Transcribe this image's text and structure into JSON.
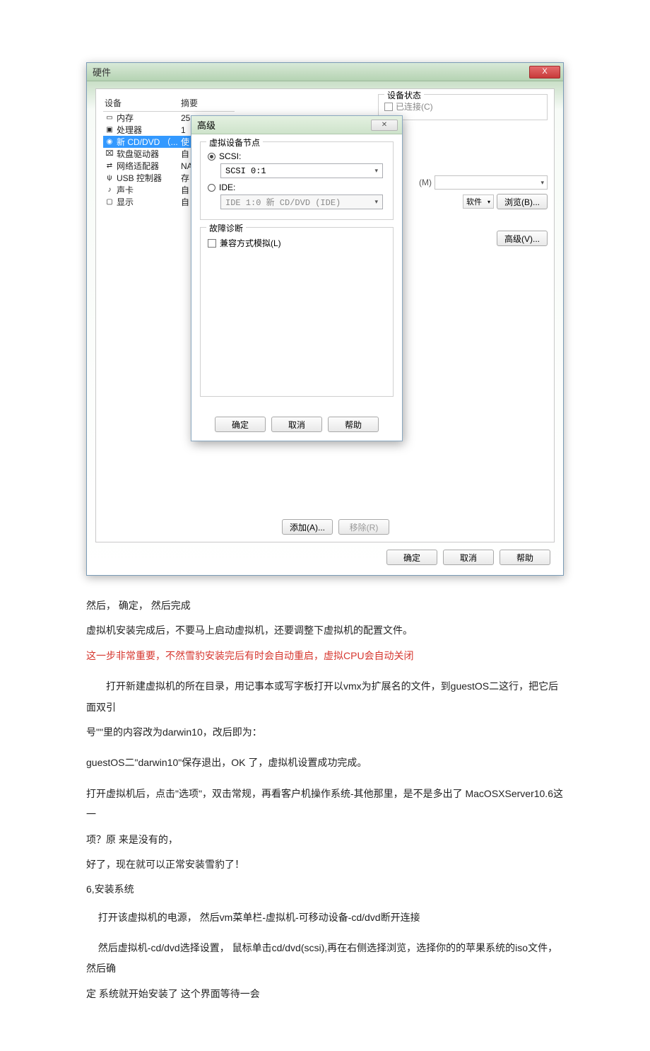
{
  "dialog": {
    "title": "硬件",
    "close_x": "X",
    "device_header": "设备",
    "summary_header": "摘要",
    "devices": [
      {
        "name": "内存",
        "summary": "25",
        "icon": "memory-icon"
      },
      {
        "name": "处理器",
        "summary": "1",
        "icon": "cpu-icon"
      },
      {
        "name": "新 CD/DVD （...",
        "summary": "使",
        "icon": "cd-icon",
        "selected": true
      },
      {
        "name": "软盘驱动器",
        "summary": "自",
        "icon": "floppy-icon"
      },
      {
        "name": "网络适配器",
        "summary": "NA",
        "icon": "nic-icon"
      },
      {
        "name": "USB 控制器",
        "summary": "存",
        "icon": "usb-icon"
      },
      {
        "name": "声卡",
        "summary": "自",
        "icon": "sound-icon"
      },
      {
        "name": "显示",
        "summary": "自",
        "icon": "display-icon"
      }
    ],
    "status_group": "设备状态",
    "status_connected": "已连接(C)",
    "m_label": "(M)",
    "browse_dd": "软件",
    "browse_btn": "浏览(B)...",
    "advanced_btn": "高级(V)...",
    "add_btn": "添加(A)...",
    "remove_btn": "移除(R)",
    "ok": "确定",
    "cancel": "取消",
    "help": "帮助"
  },
  "adv": {
    "title": "高级",
    "close_x": "✕",
    "node_group": "虚拟设备节点",
    "scsi_label": "SCSI:",
    "scsi_value": "SCSI 0:1",
    "ide_label": "IDE:",
    "ide_value": "IDE 1:0  新 CD/DVD (IDE)",
    "troubleshoot_group": "故障诊断",
    "legacy_label": "兼容方式模拟(L)",
    "ok": "确定",
    "cancel": "取消",
    "help": "帮助"
  },
  "article": {
    "p1": "然后， 确定， 然后完成",
    "p2": "虚拟机安装完成后，不要马上启动虚拟机，还要调整下虚拟机的配置文件。",
    "p3": "这一步非常重要，不然雪豹安装完后有时会自动重启，虚拟CPU会自动关闭",
    "p4": "打开新建虚拟机的所在目录，用记事本或写字板打开以vmx为扩展名的文件，到guestOS二这行，把它后面双引",
    "p5": "号\"\"里的内容改为darwin10，改后即为：",
    "p6": "guestOS二\"darwin10\"保存退出，OK 了，虚拟机设置成功完成。",
    "p7": "打开虚拟机后，点击\"选项\"，双击常规，再看客户机操作系统-其他那里，是不是多出了 MacOSXServer10.6这一",
    "p8": "项？原 来是没有的，",
    "p9": "好了，现在就可以正常安装雪豹了！",
    "p10": "6,安装系统",
    "p11": "打开该虚拟机的电源， 然后vm菜单栏-虚拟机-可移动设备-cd/dvd断开连接",
    "p12": "然后虚拟机-cd/dvd选择设置， 鼠标单击cd/dvd(scsi),再在右侧选择浏览，选择你的的苹果系统的iso文件， 然后确",
    "p13": "定  系统就开始安装了 这个界面等待一会"
  }
}
